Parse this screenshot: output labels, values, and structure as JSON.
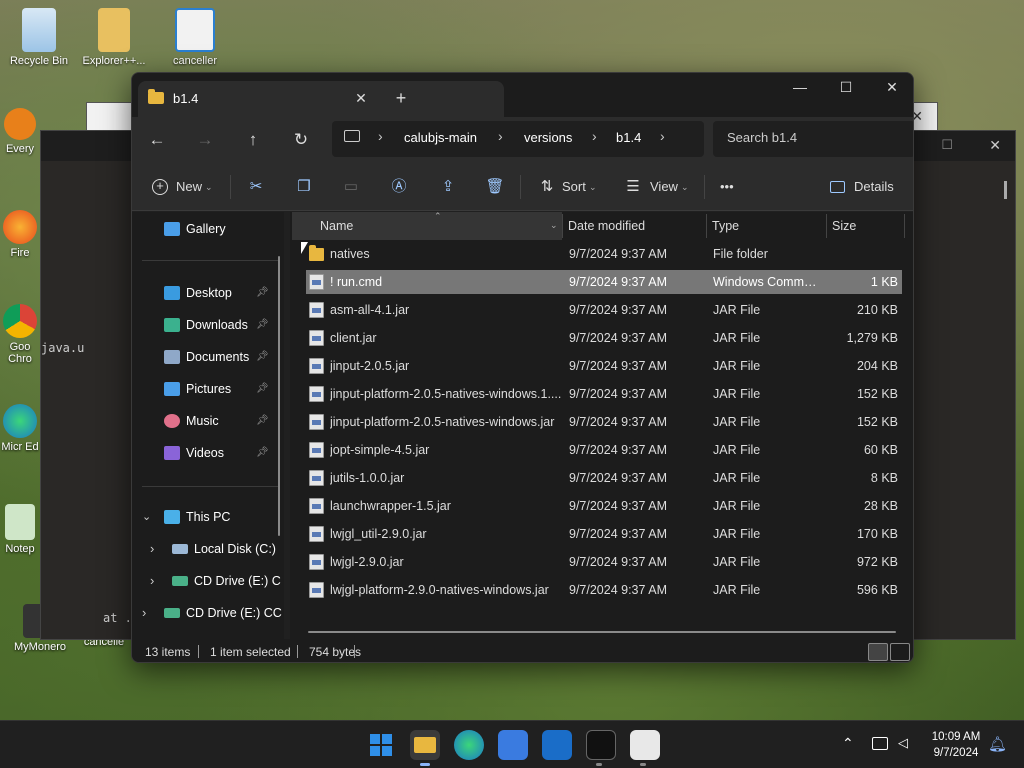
{
  "desktop": {
    "icons": [
      {
        "label": "Recycle Bin"
      },
      {
        "label": "Explorer++..."
      },
      {
        "label": "canceller"
      },
      {
        "label": "Every"
      },
      {
        "label": "Fire"
      },
      {
        "label": "Goo Chro"
      },
      {
        "label": "Micr Ed"
      },
      {
        "label": "Notep"
      },
      {
        "label": "MyMonero"
      },
      {
        "label": "cancelle"
      }
    ],
    "console_text_1": "java.u",
    "console_text_2": "at ."
  },
  "window": {
    "tab_title": "b1.4",
    "tab_close": "✕",
    "tab_add": "+",
    "minimize": "—",
    "maximize": "☐",
    "close": "✕"
  },
  "address": {
    "back": "←",
    "forward": "→",
    "up": "↑",
    "refresh": "↻",
    "breadcrumbs": [
      "calubjs-main",
      "versions",
      "b1.4"
    ],
    "search_placeholder": "Search b1.4"
  },
  "toolbar": {
    "new_label": "New",
    "sort_label": "Sort",
    "view_label": "View",
    "more_label": "•••",
    "details_label": "Details"
  },
  "nav": {
    "gallery": "Gallery",
    "quick_access": [
      {
        "label": "Desktop",
        "color": "#3a9be0"
      },
      {
        "label": "Downloads",
        "color": "#3bb18e"
      },
      {
        "label": "Documents",
        "color": "#8fa8c8"
      },
      {
        "label": "Pictures",
        "color": "#4a9ee8"
      },
      {
        "label": "Music",
        "color": "#e0708a"
      },
      {
        "label": "Videos",
        "color": "#8a64d8"
      }
    ],
    "this_pc": "This PC",
    "drives": [
      "Local Disk (C:)",
      "CD Drive (E:) C",
      "CD Drive (E:) CC"
    ]
  },
  "columns": {
    "name": "Name",
    "date": "Date modified",
    "type": "Type",
    "size": "Size"
  },
  "files": [
    {
      "name": "natives",
      "date": "9/7/2024 9:37 AM",
      "type": "File folder",
      "size": "",
      "folder": true
    },
    {
      "name": "! run.cmd",
      "date": "9/7/2024 9:37 AM",
      "type": "Windows Comma...",
      "size": "1 KB",
      "selected": true
    },
    {
      "name": "asm-all-4.1.jar",
      "date": "9/7/2024 9:37 AM",
      "type": "JAR File",
      "size": "210 KB"
    },
    {
      "name": "client.jar",
      "date": "9/7/2024 9:37 AM",
      "type": "JAR File",
      "size": "1,279 KB"
    },
    {
      "name": "jinput-2.0.5.jar",
      "date": "9/7/2024 9:37 AM",
      "type": "JAR File",
      "size": "204 KB"
    },
    {
      "name": "jinput-platform-2.0.5-natives-windows.1....",
      "date": "9/7/2024 9:37 AM",
      "type": "JAR File",
      "size": "152 KB"
    },
    {
      "name": "jinput-platform-2.0.5-natives-windows.jar",
      "date": "9/7/2024 9:37 AM",
      "type": "JAR File",
      "size": "152 KB"
    },
    {
      "name": "jopt-simple-4.5.jar",
      "date": "9/7/2024 9:37 AM",
      "type": "JAR File",
      "size": "60 KB"
    },
    {
      "name": "jutils-1.0.0.jar",
      "date": "9/7/2024 9:37 AM",
      "type": "JAR File",
      "size": "8 KB"
    },
    {
      "name": "launchwrapper-1.5.jar",
      "date": "9/7/2024 9:37 AM",
      "type": "JAR File",
      "size": "28 KB"
    },
    {
      "name": "lwjgl_util-2.9.0.jar",
      "date": "9/7/2024 9:37 AM",
      "type": "JAR File",
      "size": "170 KB"
    },
    {
      "name": "lwjgl-2.9.0.jar",
      "date": "9/7/2024 9:37 AM",
      "type": "JAR File",
      "size": "972 KB"
    },
    {
      "name": "lwjgl-platform-2.9.0-natives-windows.jar",
      "date": "9/7/2024 9:37 AM",
      "type": "JAR File",
      "size": "596 KB"
    }
  ],
  "status": {
    "count": "13 items",
    "selected": "1 item selected",
    "bytes": "754 bytes"
  },
  "taskbar": {
    "time": "10:09 AM",
    "date": "9/7/2024",
    "apps": [
      {
        "name": "start",
        "color": "#2f8fe8"
      },
      {
        "name": "file-explorer",
        "color": "#e8b73f"
      },
      {
        "name": "edge",
        "color": "#1fa0d8"
      },
      {
        "name": "store",
        "color": "#3a7be0"
      },
      {
        "name": "outlook",
        "color": "#1a6dc8"
      },
      {
        "name": "terminal",
        "color": "#3a3a3a"
      },
      {
        "name": "java",
        "color": "#e8e8e8"
      }
    ]
  }
}
